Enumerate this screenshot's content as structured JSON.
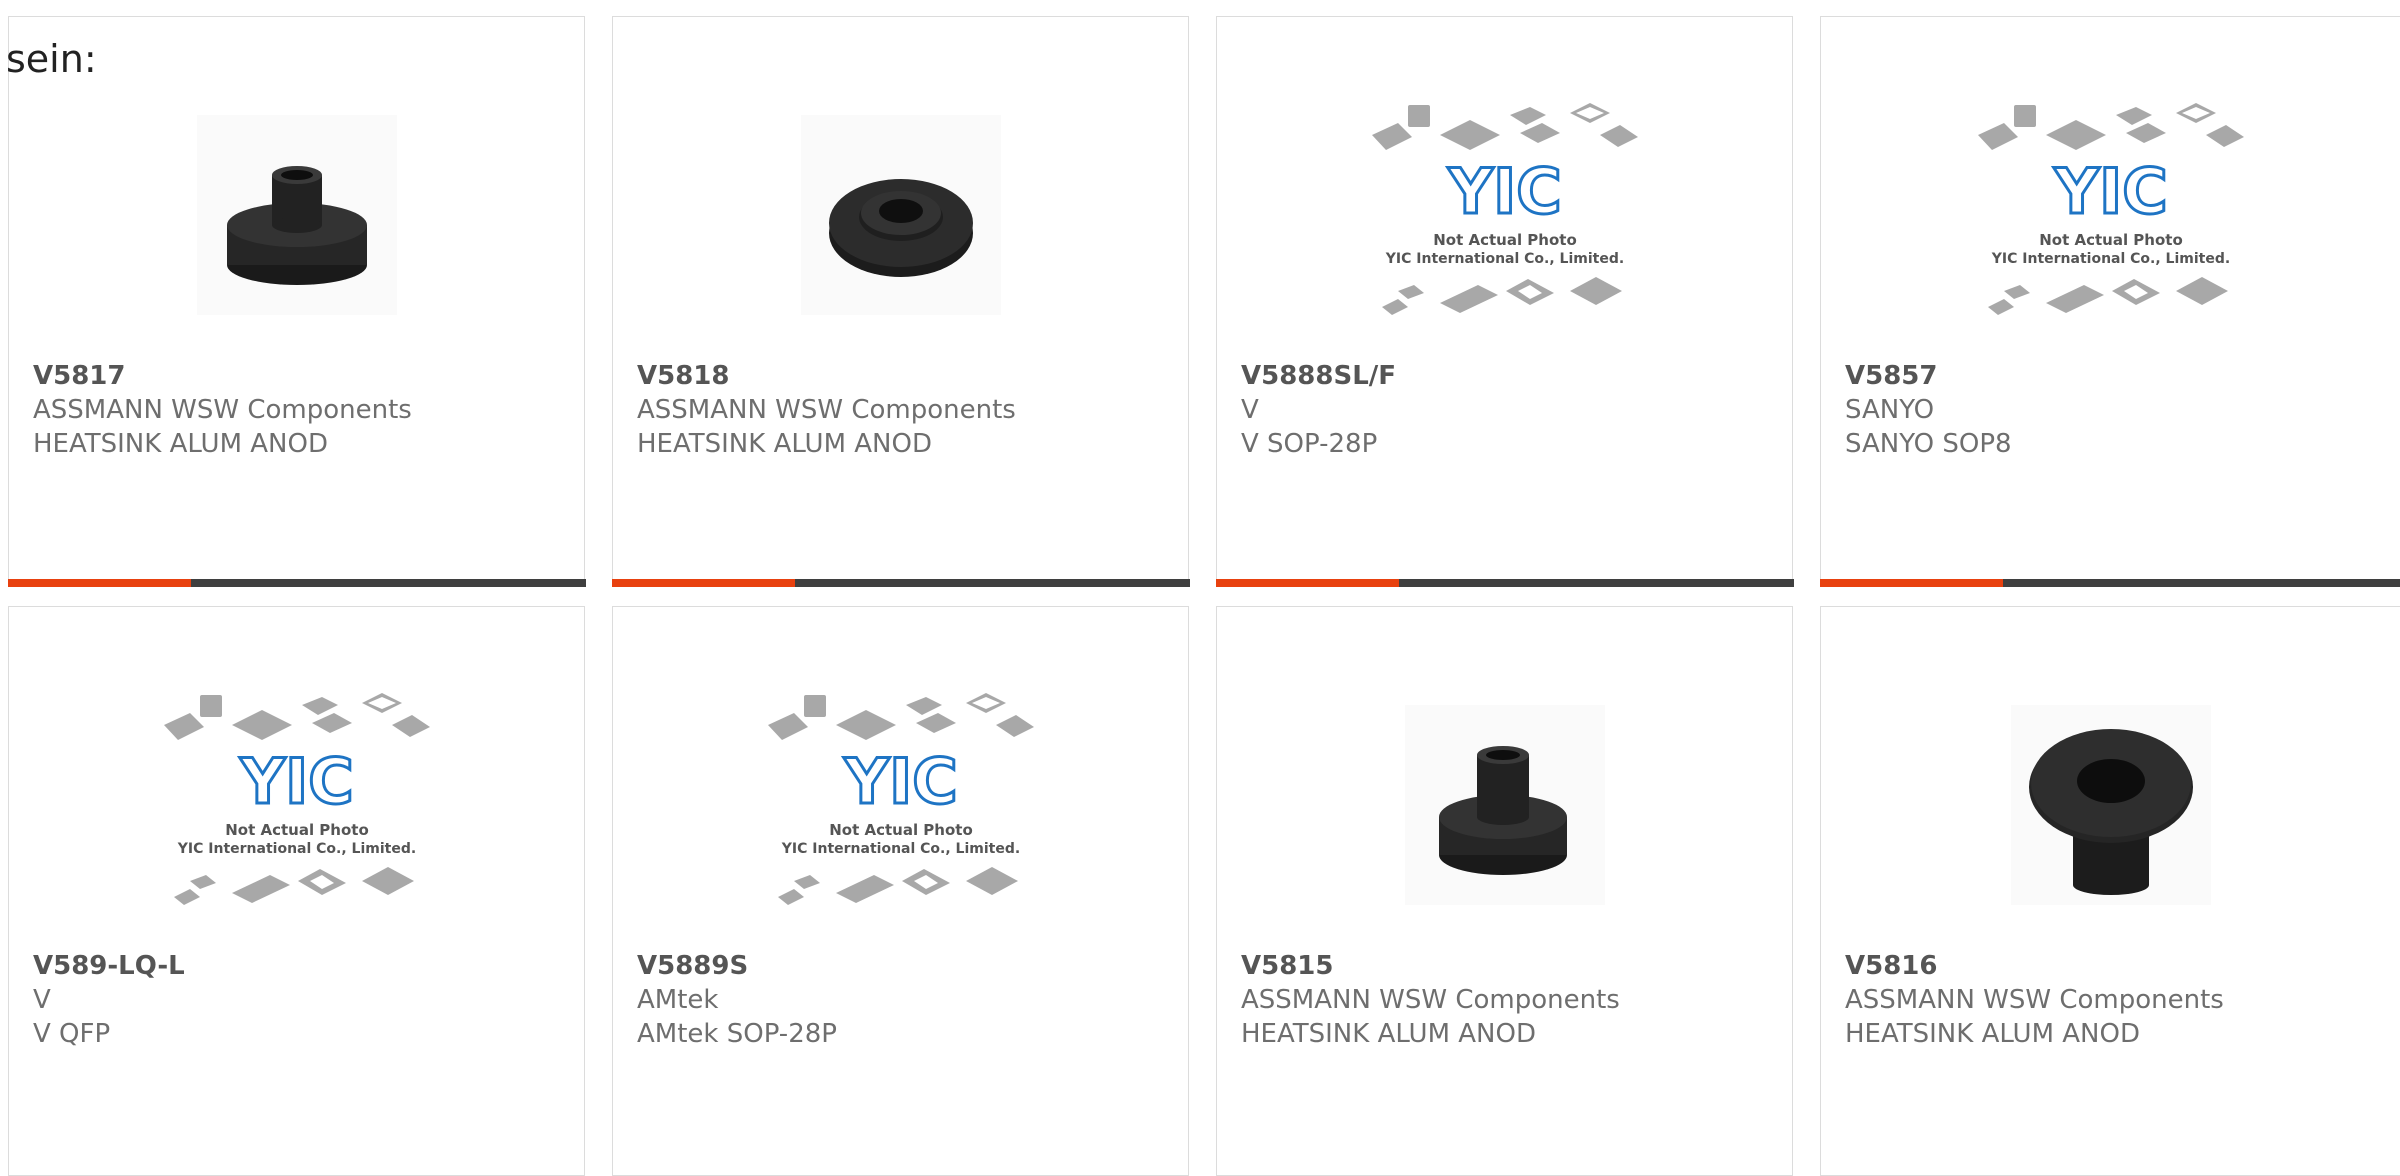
{
  "heading": "sein:",
  "colors": {
    "accent": "#e8410f",
    "bar": "#3f3f3f",
    "yic_blue": "#1e74c4",
    "placeholder_gray": "#a8a8a8"
  },
  "placeholder": {
    "logo": "YIC",
    "line1": "Not Actual Photo",
    "line2": "YIC International Co., Limited."
  },
  "products": [
    {
      "pn": "V5817",
      "mfr": "ASSMANN WSW Components",
      "desc": "HEATSINK ALUM ANOD",
      "image": "bushing-side-icon"
    },
    {
      "pn": "V5818",
      "mfr": "ASSMANN WSW Components",
      "desc": "HEATSINK ALUM ANOD",
      "image": "bushing-flat-icon"
    },
    {
      "pn": "V5888SL/F",
      "mfr": "V",
      "desc": "V SOP-28P",
      "image": "not-actual-photo-icon"
    },
    {
      "pn": "V5857",
      "mfr": "SANYO",
      "desc": "SANYO SOP8",
      "image": "not-actual-photo-icon"
    },
    {
      "pn": "V589-LQ-L",
      "mfr": "V",
      "desc": "V QFP",
      "image": "not-actual-photo-icon"
    },
    {
      "pn": "V5889S",
      "mfr": "AMtek",
      "desc": "AMtek SOP-28P",
      "image": "not-actual-photo-icon"
    },
    {
      "pn": "V5815",
      "mfr": "ASSMANN WSW Components",
      "desc": "HEATSINK ALUM ANOD",
      "image": "bushing-side-icon"
    },
    {
      "pn": "V5816",
      "mfr": "ASSMANN WSW Components",
      "desc": "HEATSINK ALUM ANOD",
      "image": "bushing-top-icon"
    }
  ]
}
